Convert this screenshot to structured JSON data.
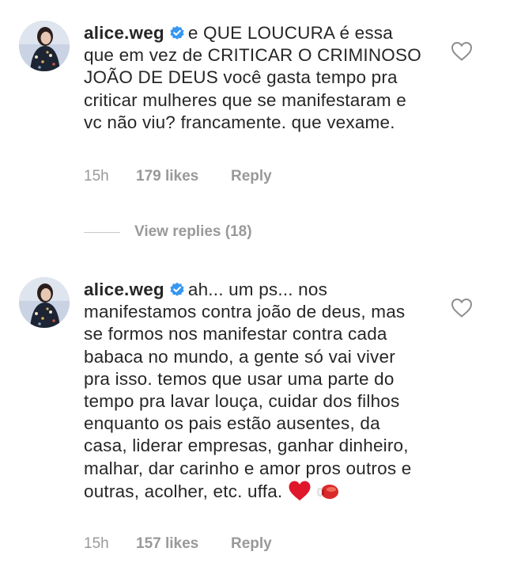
{
  "comments": [
    {
      "username": "alice.weg",
      "text": "e QUE LOUCURA é essa que em vez de CRITICAR O CRIMINOSO JOÃO DE DEUS você gasta tempo pra criticar mulheres que se manifestaram e vc não viu? francamente. que vexame.",
      "time": "15h",
      "likes": "179 likes",
      "reply": "Reply"
    },
    {
      "username": "alice.weg",
      "text": "ah... um ps... nos manifestamos contra joão de deus, mas se formos nos manifestar contra cada babaca no mundo, a gente só vai viver pra isso. temos que usar uma parte do tempo pra lavar louça, cuidar dos filhos enquanto os pais estão ausentes, da casa, liderar empresas, ganhar dinheiro, malhar, dar carinho e amor pros outros e outras, acolher, etc. uffa.",
      "time": "15h",
      "likes": "157 likes",
      "reply": "Reply"
    }
  ],
  "view_replies": "View replies (18)",
  "icons": {
    "verified": "verified-badge-icon",
    "like": "heart-outline-icon",
    "emoji_1": "red-heart-emoji",
    "emoji_2": "boxing-glove-emoji"
  },
  "colors": {
    "text": "#262626",
    "muted": "#999999",
    "verified": "#3897f0",
    "heart_emoji": "#e0162b",
    "glove": "#d92b2b"
  }
}
